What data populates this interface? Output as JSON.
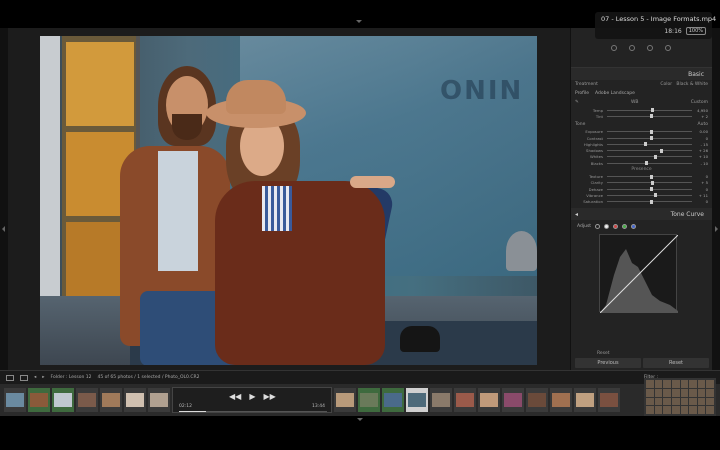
{
  "video": {
    "title": "07 - Lesson 5 - Image Formats.mp4",
    "clock": "18:16",
    "battery": "100%"
  },
  "photo": {
    "sign_text": "ONIN"
  },
  "panel": {
    "basic_header": "Basic",
    "treatment_label": "Treatment",
    "treatment_color": "Color",
    "treatment_bw": "Black & White",
    "profile_label": "Profile",
    "profile_value": "Adobe Landscape",
    "wb_label": "WB",
    "wb_value": "Custom",
    "tone_label": "Tone",
    "tone_auto": "Auto",
    "presence_label": "Presence",
    "sliders": [
      {
        "label": "Temp",
        "value": "4,950",
        "pos": 0.52
      },
      {
        "label": "Tint",
        "value": "+ 2",
        "pos": 0.51
      },
      {
        "label": "Exposure",
        "value": "0.00",
        "pos": 0.5
      },
      {
        "label": "Contrast",
        "value": "0",
        "pos": 0.5
      },
      {
        "label": "Highlights",
        "value": "- 15",
        "pos": 0.43
      },
      {
        "label": "Shadows",
        "value": "+ 26",
        "pos": 0.62
      },
      {
        "label": "Whites",
        "value": "+ 10",
        "pos": 0.55
      },
      {
        "label": "Blacks",
        "value": "- 10",
        "pos": 0.45
      },
      {
        "label": "Texture",
        "value": "0",
        "pos": 0.5
      },
      {
        "label": "Clarity",
        "value": "+ 5",
        "pos": 0.52
      },
      {
        "label": "Dehaze",
        "value": "0",
        "pos": 0.5
      },
      {
        "label": "Vibrance",
        "value": "+ 11",
        "pos": 0.55
      },
      {
        "label": "Saturation",
        "value": "0",
        "pos": 0.5
      }
    ],
    "tone_curve_header": "Tone Curve",
    "tc_adjust_label": "Adjust",
    "reset_label": "Reset",
    "previous_button": "Previous",
    "reset_button": "Reset"
  },
  "filmbar": {
    "source": "Folder : Lesson 12",
    "count": "45 of 65 photos / 1 selected / Photo_OL0.CR2",
    "filter_label": "Filter :"
  },
  "player": {
    "current_time": "02:12",
    "duration": "13:44",
    "progress": 0.18
  },
  "colors": {
    "accent_green": "#3e6a3e",
    "panel_bg": "#232323"
  }
}
